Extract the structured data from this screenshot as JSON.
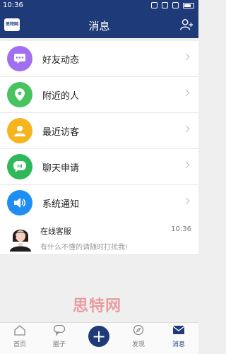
{
  "statusbar": {
    "time": "10:36"
  },
  "header": {
    "logo_text": "思特网",
    "title": "消息"
  },
  "menu": [
    {
      "label": "好友动态",
      "color": "#a26ff0",
      "icon": "chat-bubble-icon"
    },
    {
      "label": "附近的人",
      "color": "#47c45f",
      "icon": "location-pin-icon"
    },
    {
      "label": "最近访客",
      "color": "#f6b51e",
      "icon": "person-icon"
    },
    {
      "label": "聊天申请",
      "color": "#2eb85a",
      "icon": "hi-bubble-icon"
    },
    {
      "label": "系统通知",
      "color": "#1f8ef2",
      "icon": "speaker-icon"
    }
  ],
  "service": {
    "name": "在线客服",
    "time": "10:36",
    "desc": "有什么不懂的请随时打扰我!"
  },
  "watermark": "思特网",
  "bottomnav": {
    "items": [
      {
        "label": "首页"
      },
      {
        "label": "圈子"
      },
      {
        "label": "发现"
      },
      {
        "label": "消息"
      }
    ],
    "plus_label": "+"
  }
}
